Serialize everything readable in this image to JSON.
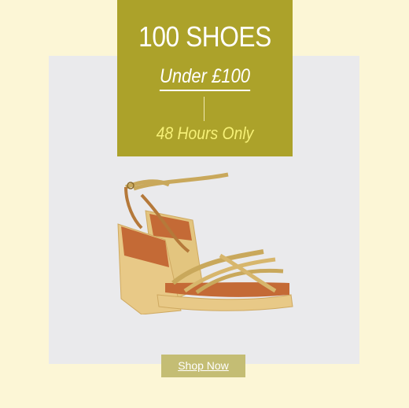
{
  "banner": {
    "title": "100 SHOES",
    "subtitle": "Under £100",
    "note": "48 Hours Only"
  },
  "cta": {
    "label": "Shop Now"
  },
  "colors": {
    "background": "#fcf6d6",
    "banner": "#aca22a",
    "panel": "#eaeaec",
    "button": "#c4bd74",
    "note_text": "#f6f076"
  },
  "product": {
    "icon": "wedge-sandal-image"
  }
}
